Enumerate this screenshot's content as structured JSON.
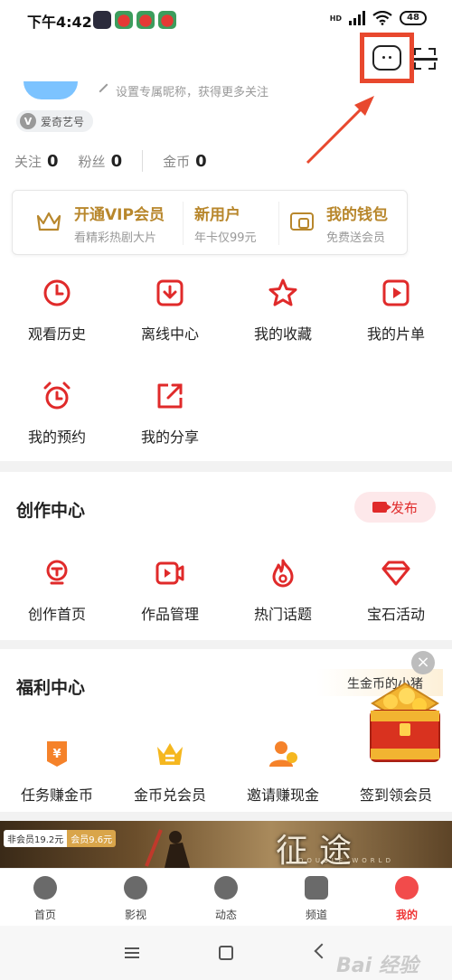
{
  "status_bar": {
    "time": "下午4:42",
    "network": "HD",
    "battery": "48"
  },
  "profile": {
    "nickname_hint": "设置专属昵称，获得更多关注",
    "id_chip": "爱奇艺号",
    "id_chip_badge": "V",
    "stats": [
      {
        "label": "关注",
        "value": "0"
      },
      {
        "label": "粉丝",
        "value": "0"
      },
      {
        "label": "金币",
        "value": "0"
      }
    ]
  },
  "vip_card": [
    {
      "title": "开通VIP会员",
      "subtitle": "看精彩热剧大片"
    },
    {
      "title": "新用户",
      "subtitle": "年卡仅99元"
    },
    {
      "title": "我的钱包",
      "subtitle": "免费送会员"
    }
  ],
  "shortcuts": [
    {
      "label": "观看历史",
      "icon": "clock-icon"
    },
    {
      "label": "离线中心",
      "icon": "download-icon"
    },
    {
      "label": "我的收藏",
      "icon": "star-icon"
    },
    {
      "label": "我的片单",
      "icon": "playlist-icon"
    },
    {
      "label": "我的预约",
      "icon": "alarm-icon"
    },
    {
      "label": "我的分享",
      "icon": "share-icon"
    }
  ],
  "creation": {
    "title": "创作中心",
    "publish_label": "发布",
    "items": [
      {
        "label": "创作首页",
        "icon": "creator-icon"
      },
      {
        "label": "作品管理",
        "icon": "video-manage-icon"
      },
      {
        "label": "热门话题",
        "icon": "fire-icon"
      },
      {
        "label": "宝石活动",
        "icon": "gem-icon"
      }
    ]
  },
  "welfare": {
    "title": "福利中心",
    "gold_banner": "生金币的小猪",
    "close_label": "×",
    "items": [
      {
        "label": "任务赚金币",
        "icon": "task-coin-icon"
      },
      {
        "label": "金币兑会员",
        "icon": "crown-coin-icon"
      },
      {
        "label": "邀请赚现金",
        "icon": "invite-user-icon"
      },
      {
        "label": "签到领会员",
        "icon": "checkin-icon"
      }
    ]
  },
  "banner": {
    "price_normal": "非会员19.2元",
    "price_member": "会员9.6元",
    "movie_title": "征途",
    "movie_sub": "DOUBLE WORLD"
  },
  "tabs": [
    {
      "label": "首页",
      "icon": "home-play-icon",
      "active": false
    },
    {
      "label": "影视",
      "icon": "film-reel-icon",
      "active": false
    },
    {
      "label": "动态",
      "icon": "feed-icon",
      "active": false
    },
    {
      "label": "频道",
      "icon": "channel-icon",
      "active": false
    },
    {
      "label": "我的",
      "icon": "profile-icon",
      "active": true
    }
  ],
  "watermark": "Bai 经验",
  "colors": {
    "accent_red": "#e02a2a",
    "vip_gold": "#b8872c",
    "highlight": "#e8482e"
  }
}
